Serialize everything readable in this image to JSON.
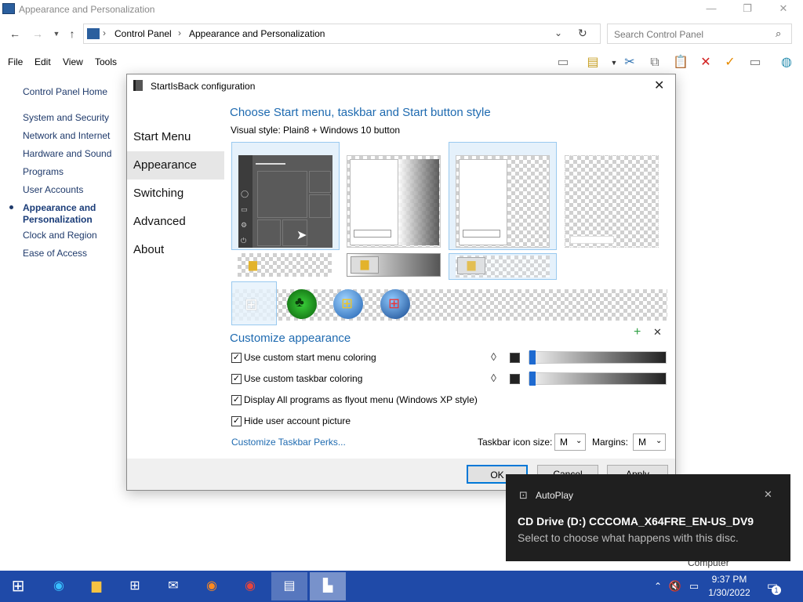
{
  "window": {
    "title": "Appearance and Personalization",
    "minimize": "—",
    "restore": "❐",
    "close": "✕"
  },
  "address": {
    "breadcrumbs": [
      "Control Panel",
      "Appearance and Personalization"
    ],
    "separator": "›",
    "search_placeholder": "Search Control Panel"
  },
  "menu": [
    "File",
    "Edit",
    "View",
    "Tools"
  ],
  "leftnav": {
    "home": "Control Panel Home",
    "items": [
      "System and Security",
      "Network and Internet",
      "Hardware and Sound",
      "Programs",
      "User Accounts",
      "Appearance and Personalization",
      "Clock and Region",
      "Ease of Access"
    ]
  },
  "dialog": {
    "title": "StartIsBack configuration",
    "tabs": [
      "Start Menu",
      "Appearance",
      "Switching",
      "Advanced",
      "About"
    ],
    "selected_tab": "Appearance",
    "heading1": "Choose Start menu, taskbar and Start button style",
    "visual_style_label": "Visual style:",
    "visual_style_value": "Plain8 + Windows 10 button",
    "heading2": "Customize appearance",
    "checkboxes": [
      {
        "label": "Use custom start menu coloring",
        "checked": true
      },
      {
        "label": "Use custom taskbar coloring",
        "checked": true
      },
      {
        "label": "Display All programs as flyout menu (Windows XP style)",
        "checked": true
      },
      {
        "label": "Hide user account picture",
        "checked": true
      }
    ],
    "link": "Customize Taskbar Perks...",
    "icon_size_label": "Taskbar icon size:",
    "icon_size_value": "M",
    "margins_label": "Margins:",
    "margins_value": "M",
    "buttons": {
      "ok": "OK",
      "cancel": "Cancel",
      "apply": "Apply"
    },
    "accent_color": "#1e6ab0"
  },
  "toast": {
    "app": "AutoPlay",
    "title": "CD Drive (D:) CCCOMA_X64FRE_EN-US_DV9",
    "body": "Select to choose what happens with this disc.",
    "behind_text": "Computer"
  },
  "taskbar": {
    "time": "9:37 PM",
    "date": "1/30/2022",
    "notification_count": "1"
  }
}
